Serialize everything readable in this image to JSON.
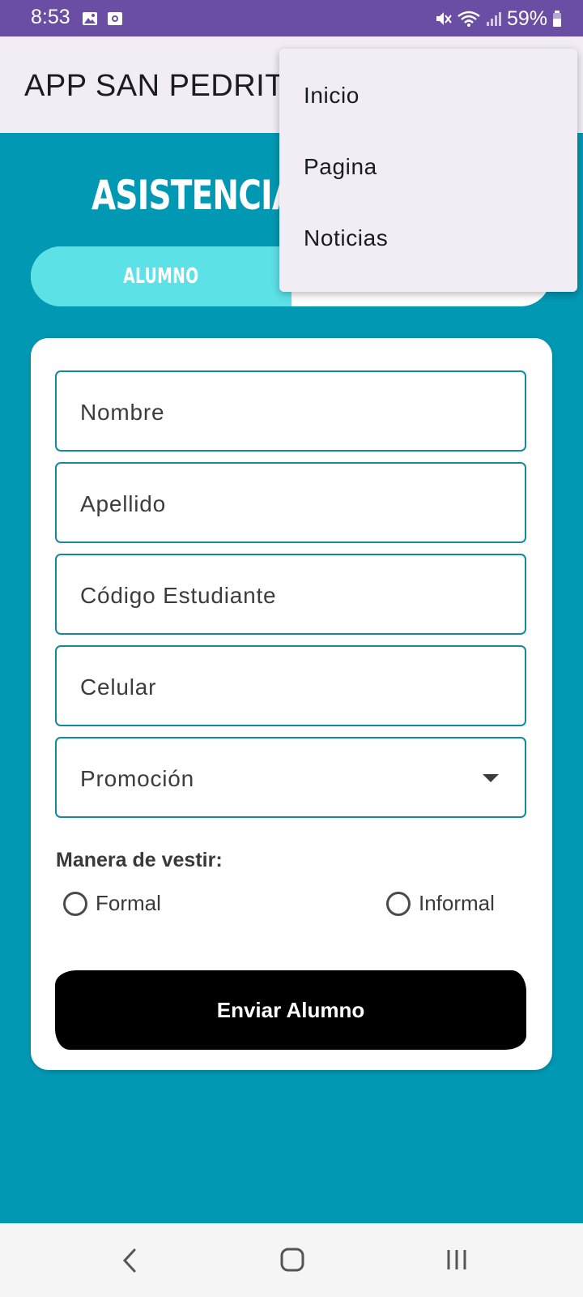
{
  "status_bar": {
    "time": "8:53",
    "battery": "59%",
    "icons": [
      "image-icon",
      "recorder-icon",
      "mute-icon",
      "wifi-icon",
      "signal-icon",
      "battery-icon"
    ]
  },
  "app_bar": {
    "title": "APP SAN PEDRIT"
  },
  "overflow_menu": {
    "items": [
      {
        "label": "Inicio"
      },
      {
        "label": "Pagina"
      },
      {
        "label": "Noticias"
      }
    ]
  },
  "page": {
    "heading": "ASISTENCIA",
    "segmented": {
      "active_label": "ALUMNO"
    }
  },
  "form": {
    "fields": [
      {
        "label": "Nombre"
      },
      {
        "label": "Apellido"
      },
      {
        "label": "Código Estudiante"
      },
      {
        "label": "Celular"
      }
    ],
    "dropdown": {
      "label": "Promoción"
    },
    "radio_group_label": "Manera de vestir:",
    "radio_options": [
      {
        "label": "Formal",
        "selected": false
      },
      {
        "label": "Informal",
        "selected": false
      }
    ],
    "submit_label": "Enviar Alumno"
  },
  "colors": {
    "status_bar": "#6a4ea3",
    "app_bar": "#f2ecf5",
    "background": "#0098b3",
    "segment_active": "#5ce1e6",
    "field_border": "#128a9c",
    "submit_bg": "#000000"
  },
  "nav_bar": {
    "icons": [
      "back-icon",
      "home-icon",
      "recents-icon"
    ]
  }
}
